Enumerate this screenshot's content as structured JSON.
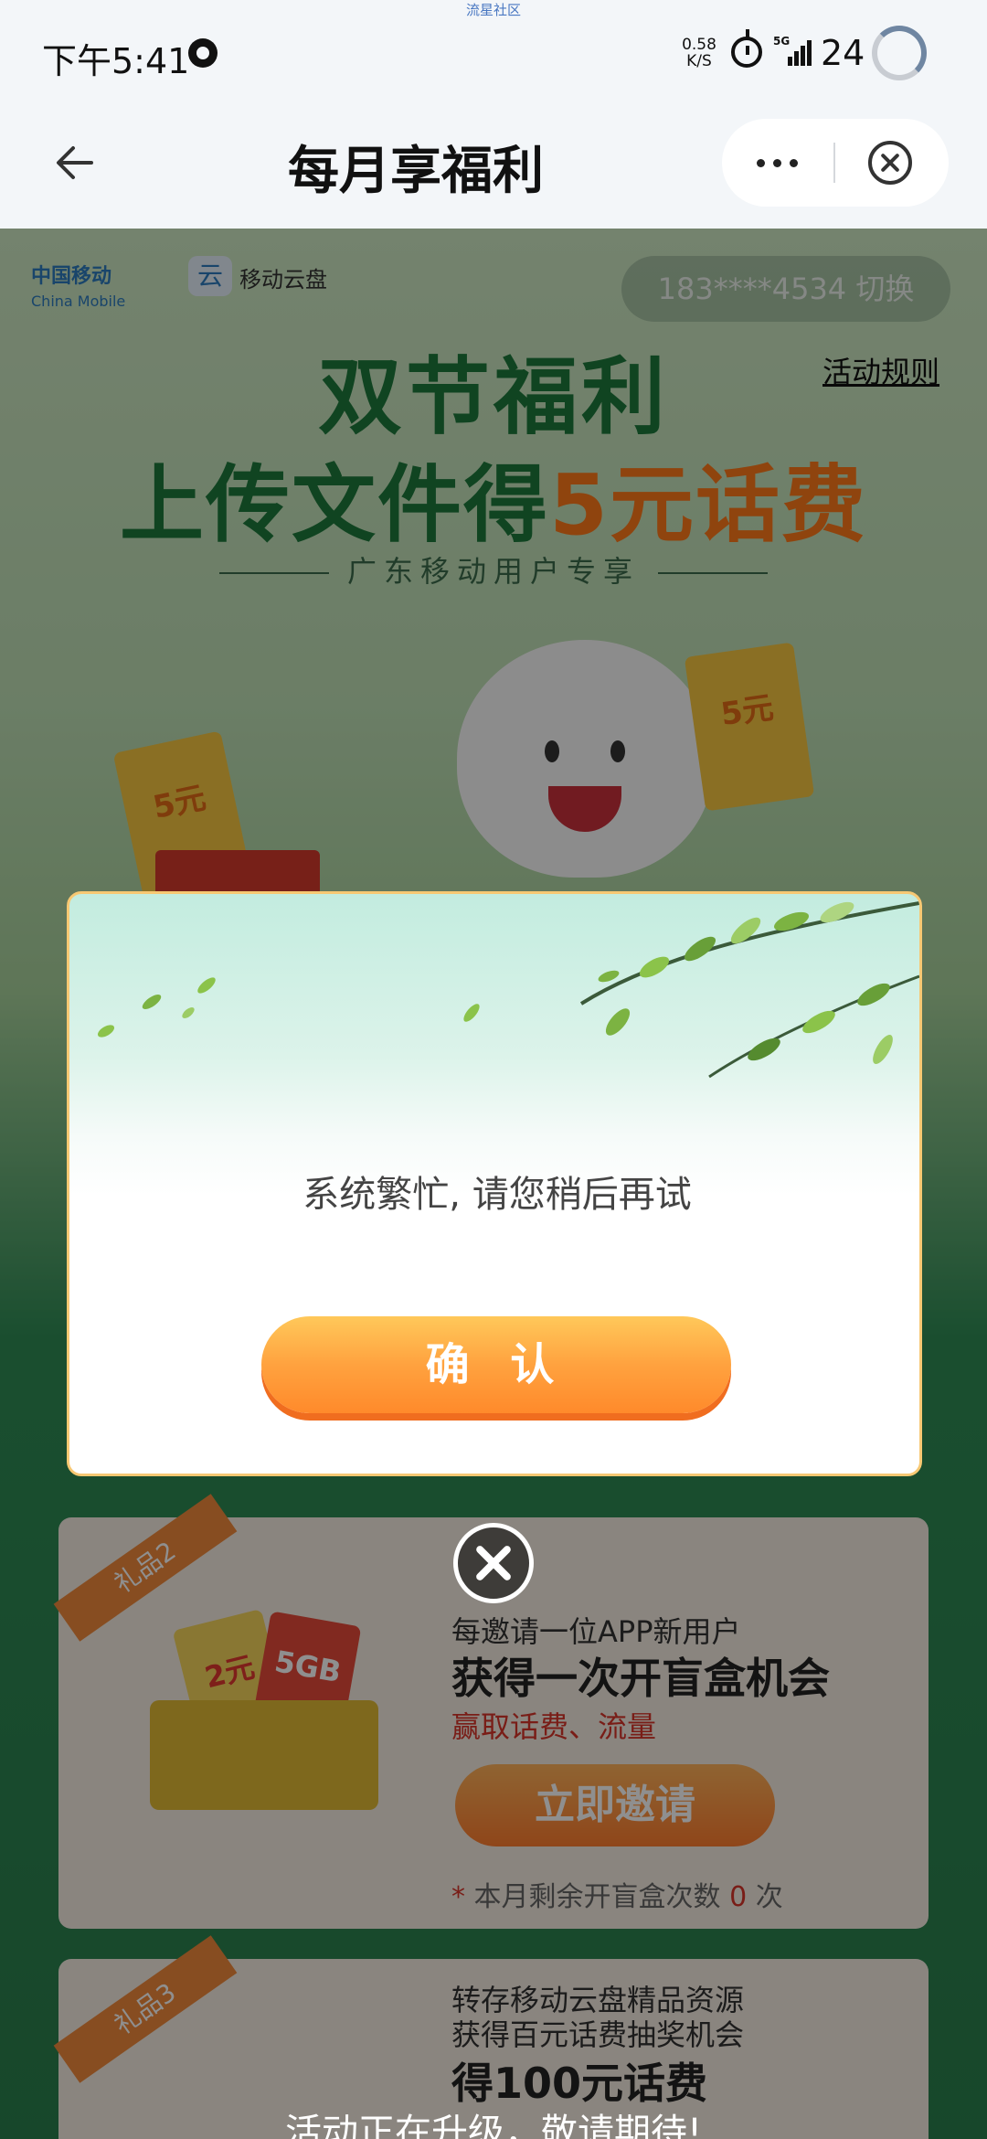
{
  "status_bar": {
    "carrier_tag": "流星社区",
    "time": "下午5:41",
    "net_speed_value": "0.58",
    "net_speed_unit": "K/S",
    "network_type": "5G",
    "battery_level": "24"
  },
  "nav": {
    "title": "每月享福利"
  },
  "page": {
    "brand_name": "中国移动",
    "brand_sub": "China Mobile",
    "cloud_brand": "移动云盘",
    "phone_switch": "183****4534 切换",
    "rules_link": "活动规则",
    "hero_line1": "双节福利",
    "hero_line2_prefix": "上传文件得",
    "hero_line2_highlight": "5元话费",
    "hero_sub": "广东移动用户专享",
    "ticket_label_a": "5元",
    "ticket_label_b": "5元",
    "gift2": {
      "ribbon": "礼品2",
      "desc": "每邀请一位APP新用户",
      "headline": "获得一次开盲盒机会",
      "tagline": "赢取话费、流量",
      "button": "立即邀请",
      "remaining_prefix": "本月剩余开盲盒次数",
      "remaining_count": "0",
      "remaining_suffix": "次",
      "card_a": "2元",
      "card_b": "5GB"
    },
    "gift3": {
      "ribbon": "礼品3",
      "desc1": "转存移动云盘精品资源",
      "desc2": "获得百元话费抽奖机会",
      "headline": "得100元话费"
    },
    "coming_soon": "活动正在升级，敬请期待!"
  },
  "modal": {
    "message": "系统繁忙, 请您稍后再试",
    "confirm_label": "确 认"
  },
  "colors": {
    "accent_orange": "#ff8a2b",
    "hero_green": "#1e7a3c",
    "highlight_red": "#d8352a"
  }
}
